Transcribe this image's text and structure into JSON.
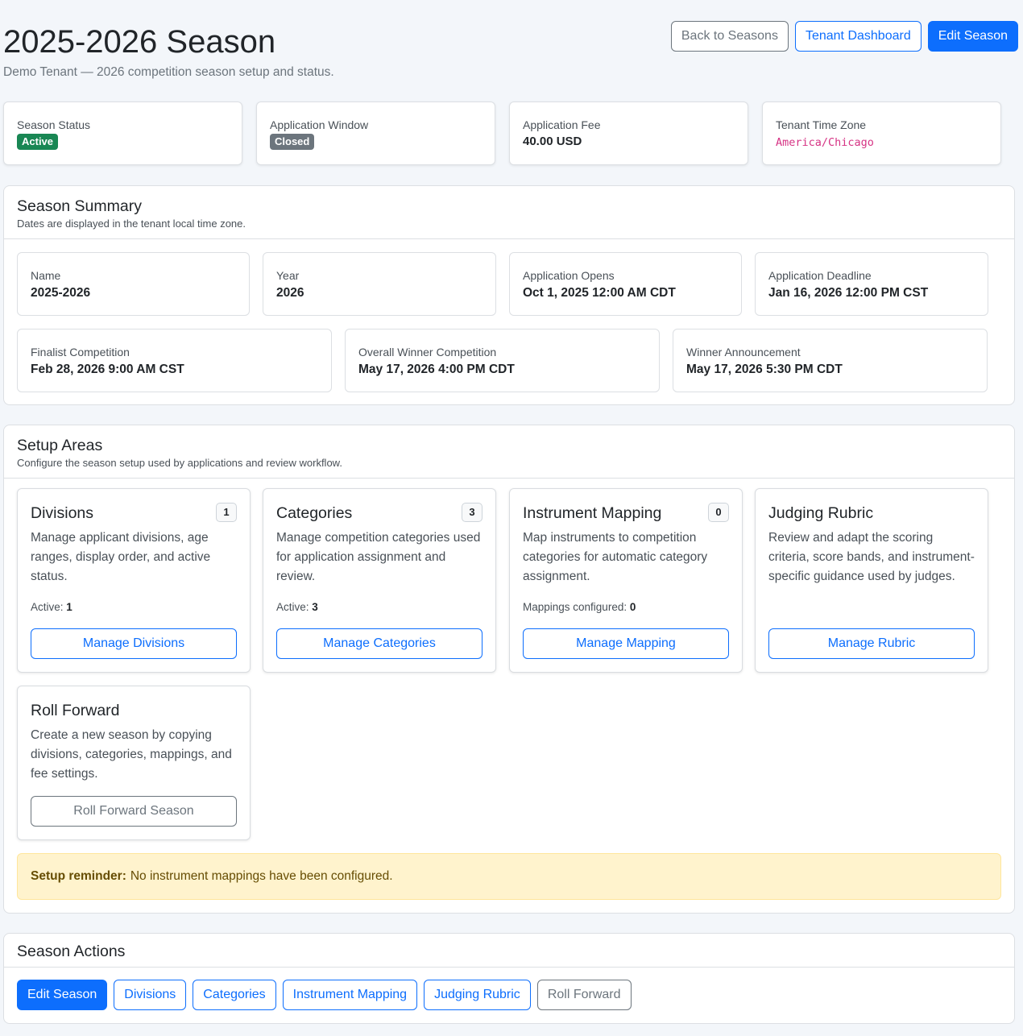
{
  "header": {
    "title": "2025-2026 Season",
    "subtitle": "Demo Tenant — 2026 competition season setup and status.",
    "buttons": {
      "back": "Back to Seasons",
      "dashboard": "Tenant Dashboard",
      "edit": "Edit Season"
    }
  },
  "stats": {
    "season_status": {
      "label": "Season Status",
      "value": "Active"
    },
    "application_window": {
      "label": "Application Window",
      "value": "Closed"
    },
    "application_fee": {
      "label": "Application Fee",
      "value": "40.00 USD"
    },
    "time_zone": {
      "label": "Tenant Time Zone",
      "value": "America/Chicago"
    }
  },
  "summary": {
    "title": "Season Summary",
    "subtitle": "Dates are displayed in the tenant local time zone.",
    "fields": [
      {
        "label": "Name",
        "value": "2025-2026"
      },
      {
        "label": "Year",
        "value": "2026"
      },
      {
        "label": "Application Opens",
        "value": "Oct 1, 2025 12:00 AM CDT"
      },
      {
        "label": "Application Deadline",
        "value": "Jan 16, 2026 12:00 PM CST"
      },
      {
        "label": "Finalist Competition",
        "value": "Feb 28, 2026 9:00 AM CST"
      },
      {
        "label": "Overall Winner Competition",
        "value": "May 17, 2026 4:00 PM CDT"
      },
      {
        "label": "Winner Announcement",
        "value": "May 17, 2026 5:30 PM CDT"
      }
    ]
  },
  "setup": {
    "title": "Setup Areas",
    "subtitle": "Configure the season setup used by applications and review workflow.",
    "areas": [
      {
        "title": "Divisions",
        "count": "1",
        "description": "Manage applicant divisions, age ranges, display order, and active status.",
        "meta_label": "Active:",
        "meta_value": "1",
        "button": "Manage Divisions"
      },
      {
        "title": "Categories",
        "count": "3",
        "description": "Manage competition categories used for application assignment and review.",
        "meta_label": "Active:",
        "meta_value": "3",
        "button": "Manage Categories"
      },
      {
        "title": "Instrument Mapping",
        "count": "0",
        "description": "Map instruments to competition categories for automatic category assignment.",
        "meta_label": "Mappings configured:",
        "meta_value": "0",
        "button": "Manage Mapping"
      },
      {
        "title": "Judging Rubric",
        "description": "Review and adapt the scoring criteria, score bands, and instrument-specific guidance used by judges.",
        "button": "Manage Rubric"
      },
      {
        "title": "Roll Forward",
        "description": "Create a new season by copying divisions, categories, mappings, and fee settings.",
        "button": "Roll Forward Season"
      }
    ],
    "alert": {
      "strong": "Setup reminder:",
      "text": "No instrument mappings have been configured."
    }
  },
  "actions": {
    "title": "Season Actions",
    "buttons": {
      "edit": "Edit Season",
      "divisions": "Divisions",
      "categories": "Categories",
      "mapping": "Instrument Mapping",
      "rubric": "Judging Rubric",
      "roll_forward": "Roll Forward"
    }
  },
  "colors": {
    "primary": "#0d6efd",
    "success": "#198754",
    "secondary": "#6c757d",
    "warning_bg": "#fff3cd",
    "code": "#d63384"
  }
}
